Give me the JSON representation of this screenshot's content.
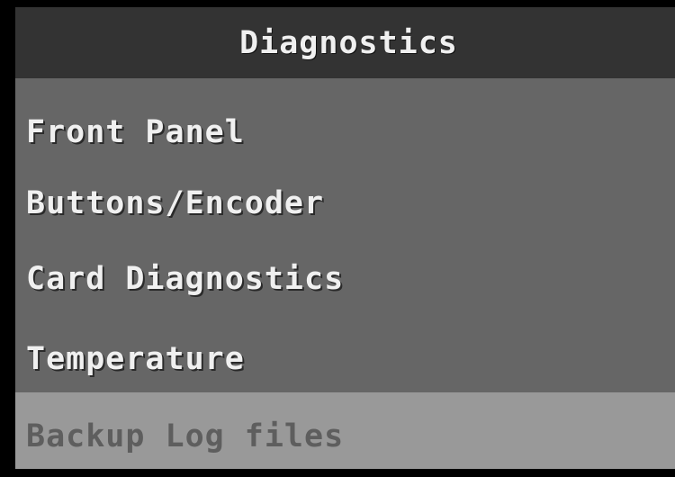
{
  "screen": {
    "title": "Diagnostics",
    "menu_items": [
      {
        "label": "Front Panel",
        "selected": false
      },
      {
        "label": "Buttons/Encoder",
        "selected": false
      },
      {
        "label": "Card Diagnostics",
        "selected": false
      },
      {
        "label": "Temperature",
        "selected": false
      },
      {
        "label": "Backup Log files",
        "selected": true
      }
    ]
  },
  "colors": {
    "frame": "#000000",
    "title_background": "#333333",
    "menu_background": "#666666",
    "selected_background": "#999999",
    "text": "#f0f0f0",
    "selected_text": "#5e5e5e"
  }
}
